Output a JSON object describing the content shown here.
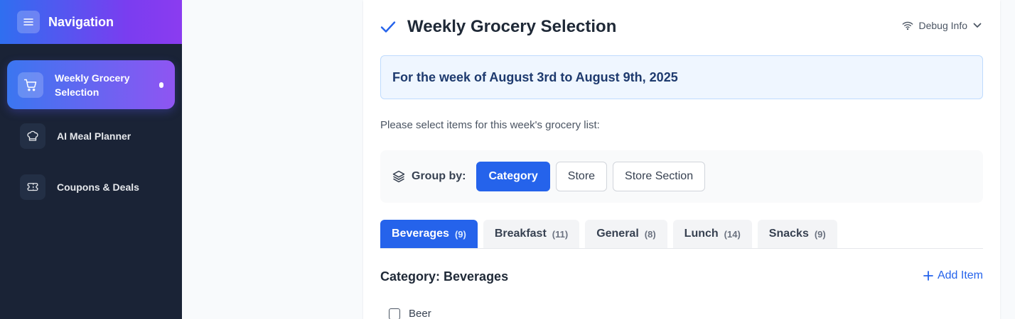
{
  "nav": {
    "title": "Navigation",
    "items": [
      {
        "label": "Weekly Grocery Selection",
        "icon": "cart-icon",
        "active": true
      },
      {
        "label": "AI Meal Planner",
        "icon": "chef-hat-icon",
        "active": false
      },
      {
        "label": "Coupons & Deals",
        "icon": "ticket-icon",
        "active": false
      }
    ]
  },
  "main": {
    "title": "Weekly Grocery Selection",
    "debug_label": "Debug Info",
    "week_text": "For the week of August 3rd to August 9th, 2025",
    "prompt": "Please select items for this week's grocery list:",
    "group_by": {
      "label": "Group by:",
      "options": [
        "Category",
        "Store",
        "Store Section"
      ],
      "selected": "Category"
    },
    "tabs": [
      {
        "label": "Beverages",
        "count": "(9)"
      },
      {
        "label": "Breakfast",
        "count": "(11)"
      },
      {
        "label": "General",
        "count": "(8)"
      },
      {
        "label": "Lunch",
        "count": "(14)"
      },
      {
        "label": "Snacks",
        "count": "(9)"
      }
    ],
    "category_title": "Category: Beverages",
    "add_item_label": "Add Item",
    "items": [
      {
        "label": "Beer",
        "checked": false
      }
    ]
  },
  "colors": {
    "accent": "#2563eb",
    "sidebar_bg": "#1a2336",
    "week_box_bg": "#eff6ff"
  }
}
